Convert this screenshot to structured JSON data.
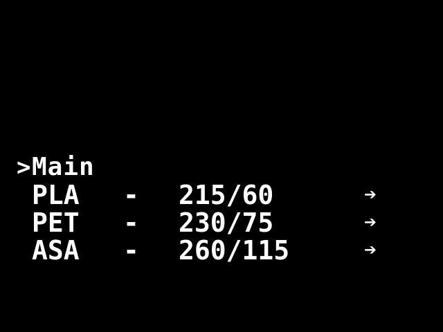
{
  "menu": {
    "cursor": ">",
    "title": "Main",
    "items": [
      {
        "material": "PLA",
        "separator": "-",
        "temps": "215/60",
        "arrow": "➔"
      },
      {
        "material": "PET",
        "separator": "-",
        "temps": "230/75",
        "arrow": "➔"
      },
      {
        "material": "ASA",
        "separator": "-",
        "temps": "260/115",
        "arrow": "➔"
      }
    ]
  },
  "colors": {
    "background": "#000000",
    "foreground": "#ffffff"
  }
}
